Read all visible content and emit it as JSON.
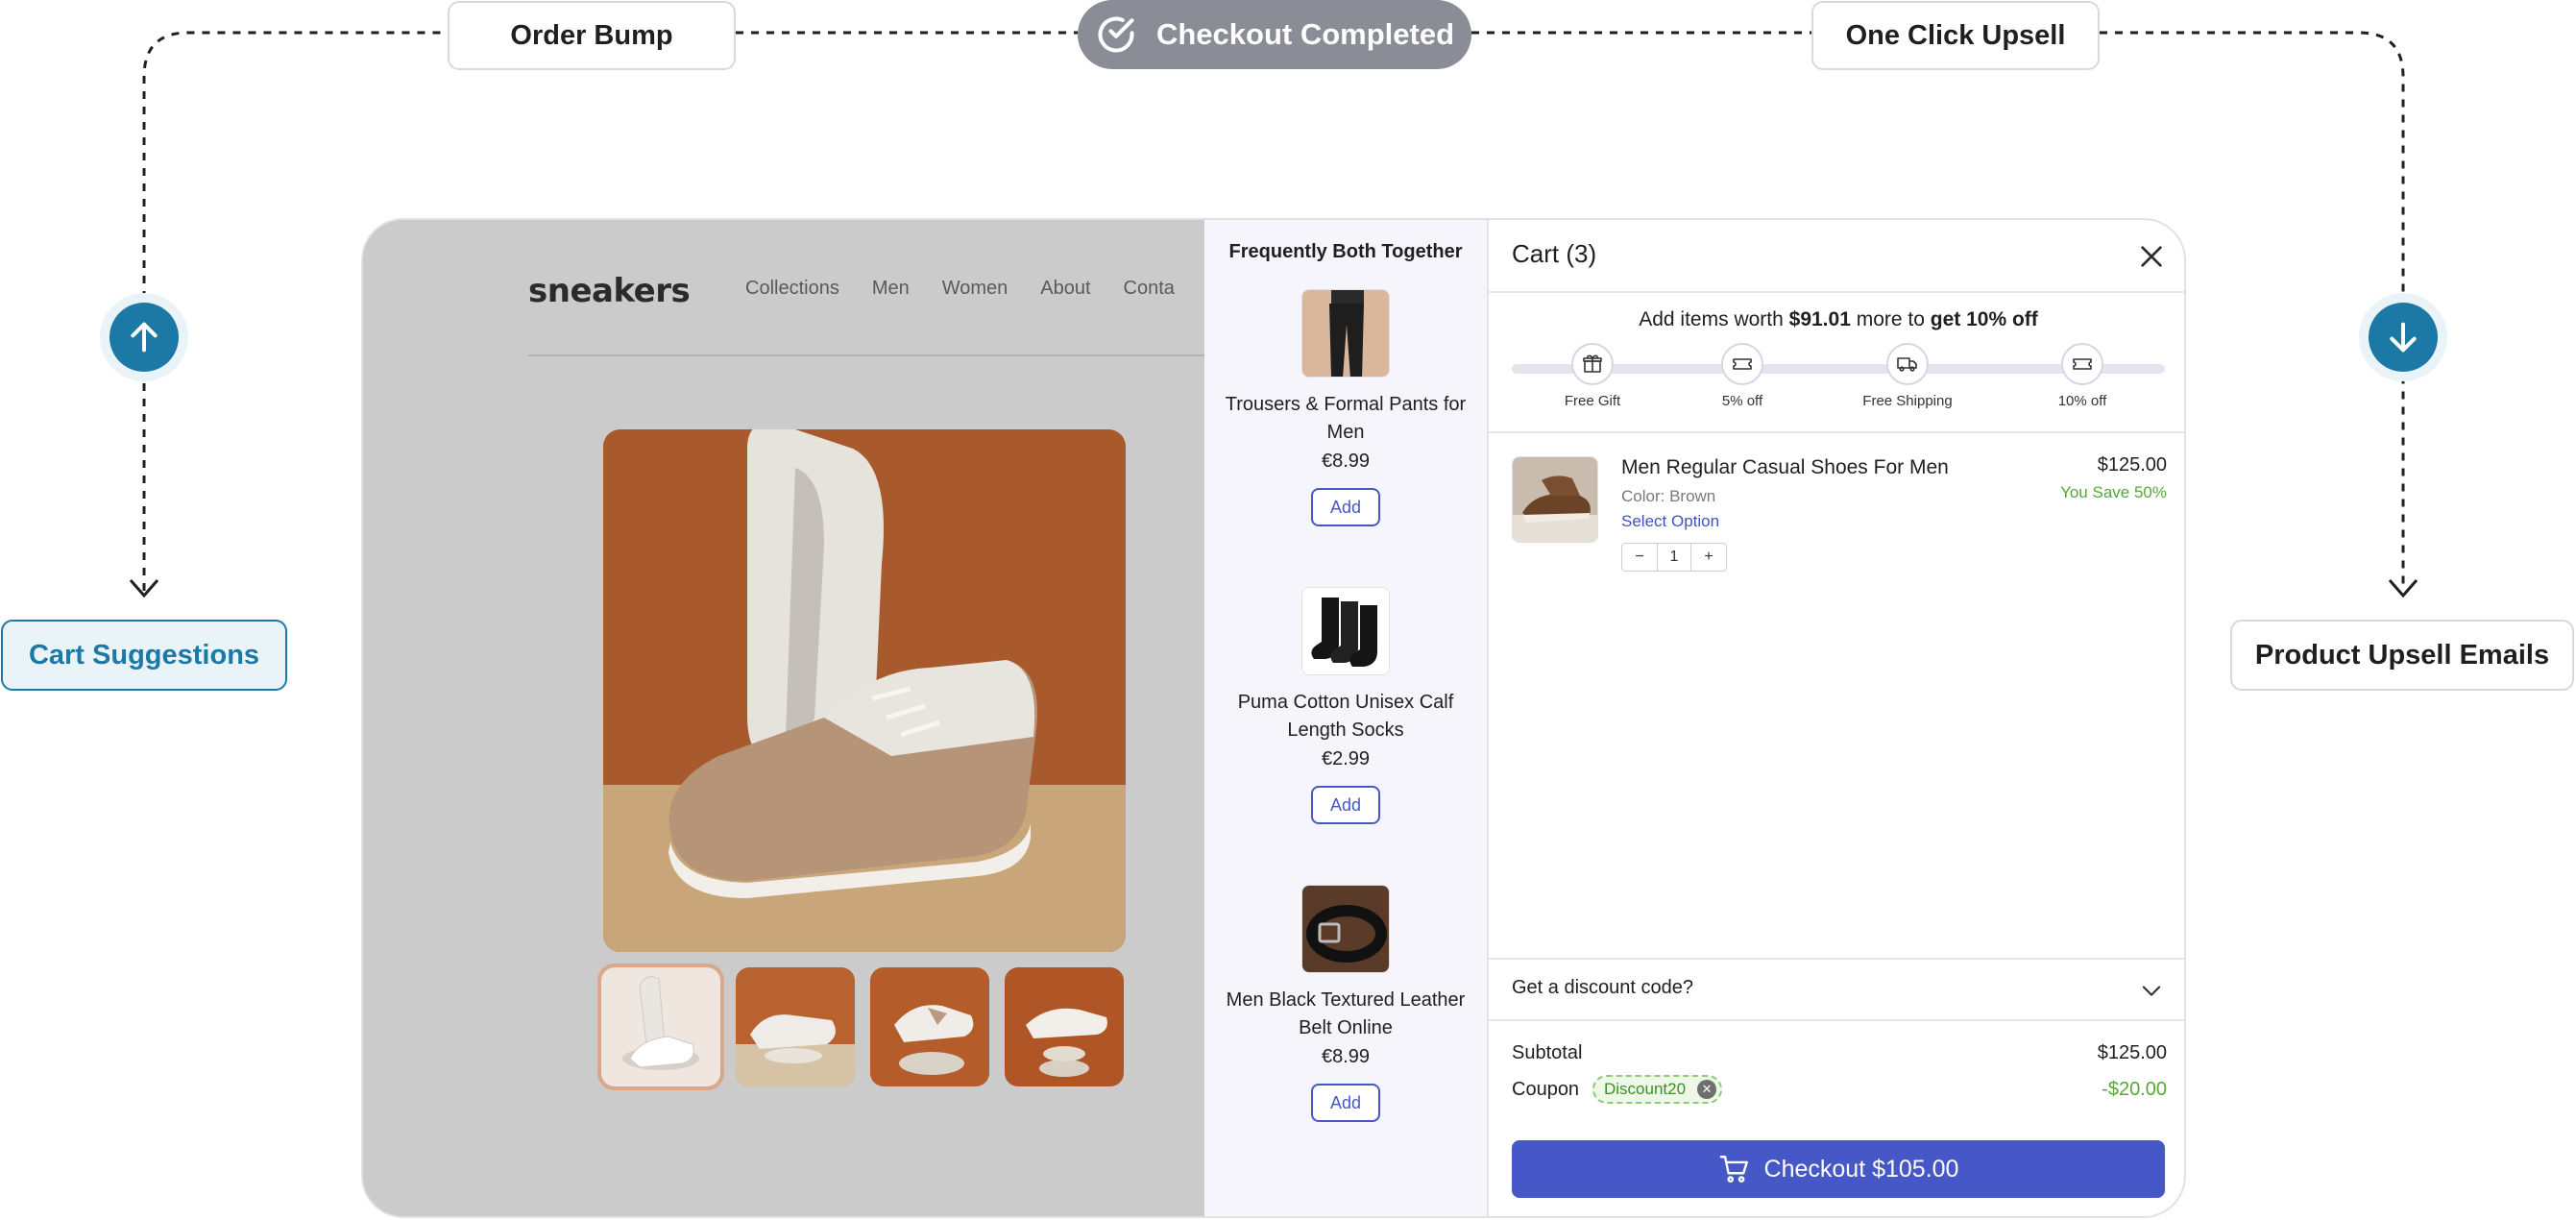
{
  "flow": {
    "order_bump": "Order Bump",
    "checkout_completed": "Checkout Completed",
    "one_click_upsell": "One Click Upsell",
    "cart_suggestions": "Cart Suggestions",
    "product_upsell_emails": "Product Upsell Emails"
  },
  "store": {
    "logo": "sneakers",
    "nav": [
      "Collections",
      "Men",
      "Women",
      "About",
      "Conta"
    ]
  },
  "fbt": {
    "title": "Frequently Both Together",
    "items": [
      {
        "name": "Trousers & Formal Pants for Men",
        "price": "€8.99",
        "add_label": "Add"
      },
      {
        "name": "Puma Cotton Unisex Calf Length Socks",
        "price": "€2.99",
        "add_label": "Add"
      },
      {
        "name": "Men Black Textured Leather Belt Online",
        "price": "€8.99",
        "add_label": "Add"
      }
    ]
  },
  "cart": {
    "title": "Cart (3)",
    "reward": {
      "prefix": "Add items worth ",
      "amount": "$91.01",
      "middle": " more to ",
      "goal": "get 10% off"
    },
    "milestones": [
      "Free Gift",
      "5% off",
      "Free Shipping",
      "10% off"
    ],
    "line": {
      "name": "Men Regular Casual Shoes For Men",
      "color": "Color: Brown",
      "select_option": "Select Option",
      "price": "$125.00",
      "savings": "You Save 50%",
      "qty_minus": "−",
      "qty": "1",
      "qty_plus": "+"
    },
    "discount_label": "Get a discount code?",
    "subtotal_label": "Subtotal",
    "subtotal_value": "$125.00",
    "coupon_label": "Coupon",
    "coupon_code": "Discount20",
    "coupon_value": "-$20.00",
    "checkout_label": "Checkout $105.00"
  },
  "colors": {
    "accent": "#4658c7",
    "flow_blue": "#1c78a5",
    "savings_green": "#56a836"
  }
}
